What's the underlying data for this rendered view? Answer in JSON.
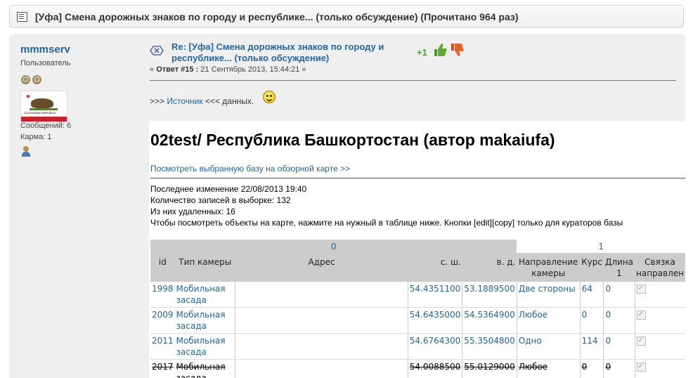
{
  "topic": {
    "title": "[Уфа] Смена дорожных знаков по городу и республике... (только обсуждение)  (Прочитано 964 раз)"
  },
  "poster": {
    "name": "mmmserv",
    "group": "Пользователь",
    "messages": "Сообщений: 6",
    "karma": "Карма: 1",
    "avatar_text": "CALIFORNIA REPUBLIC"
  },
  "post": {
    "title_line1": "Re: [Уфа] Смена дорожных знаков по городу и",
    "title_line2": "республике... (только обсуждение)",
    "meta_prefix": "« ",
    "meta_reply": "Ответ #15 :",
    "meta_date": " 21 Сентябрь 2013, 15:44:21 »",
    "karma_plus": "+1",
    "source_prefix": ">>> ",
    "source_link": "Источник",
    "source_suffix": " <<< данных."
  },
  "embed": {
    "title": "02test/ Республика Башкортостан (автор makaiufa)",
    "map_link": "Посмотреть выбранную базу на обзорной карте >>",
    "last_change": "Последнее изменение 22/08/2013 19:40",
    "records": "Количество записей в выборке: 132",
    "deleted": "Из них удаленных: 16",
    "hint": "Чтобы посмотреть объекты на карте, нажмите на нужный в таблице ниже. Кнопки [edit][copy] только для кураторов базы"
  },
  "table": {
    "groups": [
      "0",
      "1"
    ],
    "headers": {
      "id": "id",
      "type": "Тип камеры",
      "address": "Адрес",
      "lat": "с. ш.",
      "lon": "в. д.",
      "direction": "Направление камеры",
      "course": "Курс",
      "length": "Длина 1",
      "link": "Связка направлен"
    },
    "rows": [
      {
        "id": "1998",
        "type": "Мобильная засада",
        "address": "",
        "lat": "54.4351100",
        "lon": "53.1889500",
        "direction": "Две стороны",
        "course": "64",
        "length": "0"
      },
      {
        "id": "2009",
        "type": "Мобильная засада",
        "address": "",
        "lat": "54.6435000",
        "lon": "54.5364900",
        "direction": "Любое",
        "course": "0",
        "length": "0"
      },
      {
        "id": "2011",
        "type": "Мобильная засада",
        "address": "",
        "lat": "54.6764300",
        "lon": "55.3504800",
        "direction": "Одно",
        "course": "114",
        "length": "0"
      },
      {
        "id": "2017",
        "type": "Мобильная засада",
        "address": "",
        "lat": "54.0088500",
        "lon": "55.0129000",
        "direction": "Любое",
        "course": "0",
        "length": "0",
        "deleted": true
      }
    ]
  },
  "colors": {
    "link": "#2a6496",
    "panel": "#efefef",
    "karma_plus": "#4aa530",
    "thumb_up": "#5fa834",
    "thumb_down": "#e8632c"
  },
  "icons": [
    "topic-icon",
    "star-icon",
    "profile-icon",
    "xbox-icon",
    "thumb-up-icon",
    "thumb-down-icon",
    "smiley-icon"
  ]
}
